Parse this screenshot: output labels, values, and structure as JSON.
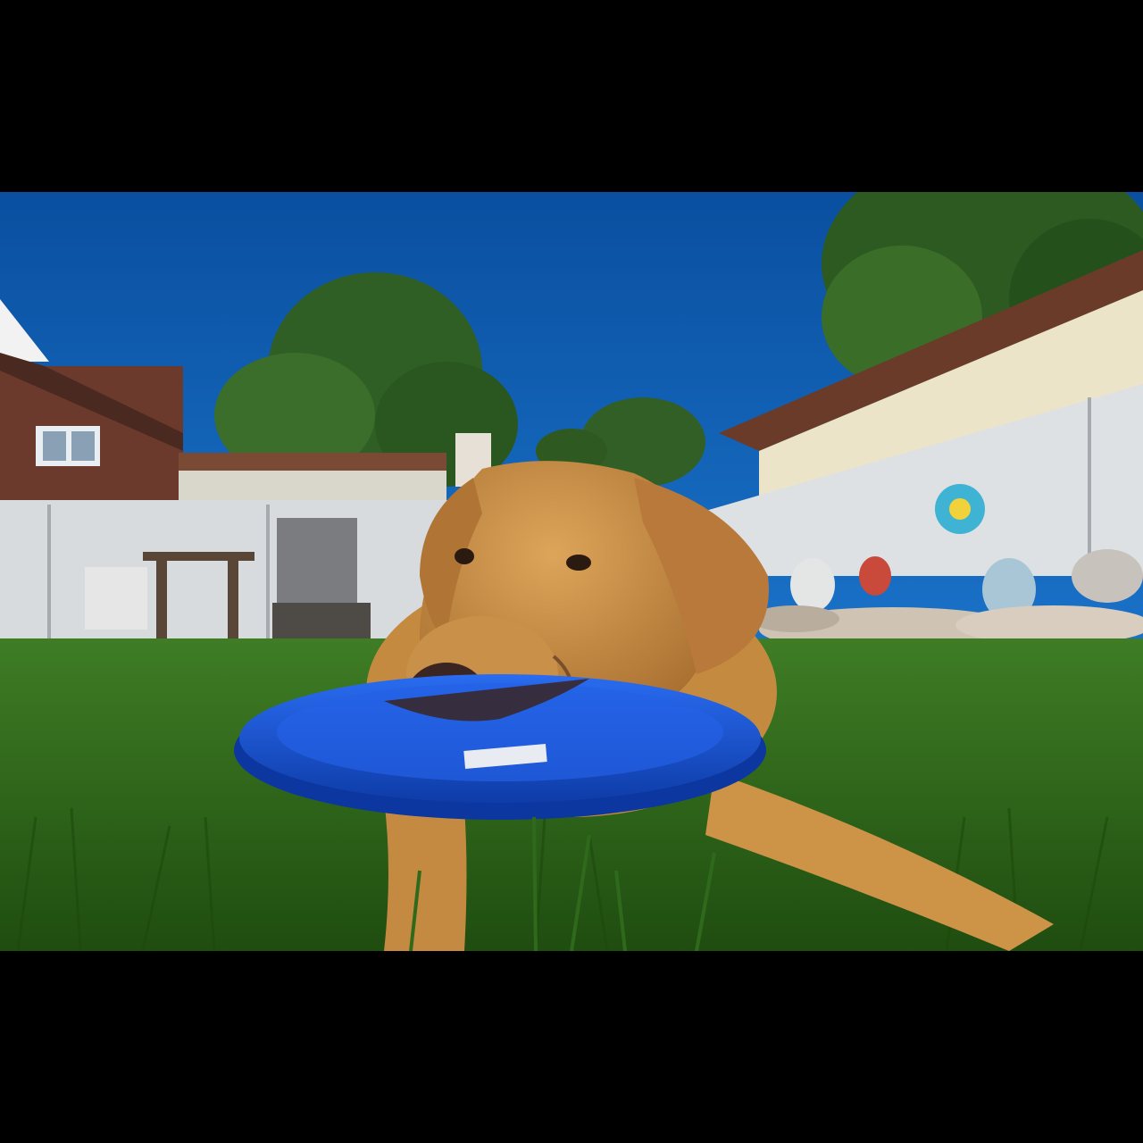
{
  "image": {
    "description_colors": {
      "letterbox": "#000000",
      "sky": "#0d62b8",
      "grass": "#2f6a1c",
      "dog_fur": "#c98f45",
      "frisbee": "#1550d6",
      "house_left": "#6b3a2c",
      "house_right": "#e9e2c7",
      "fence": "#d9dde0",
      "tree": "#2e5a22"
    }
  }
}
